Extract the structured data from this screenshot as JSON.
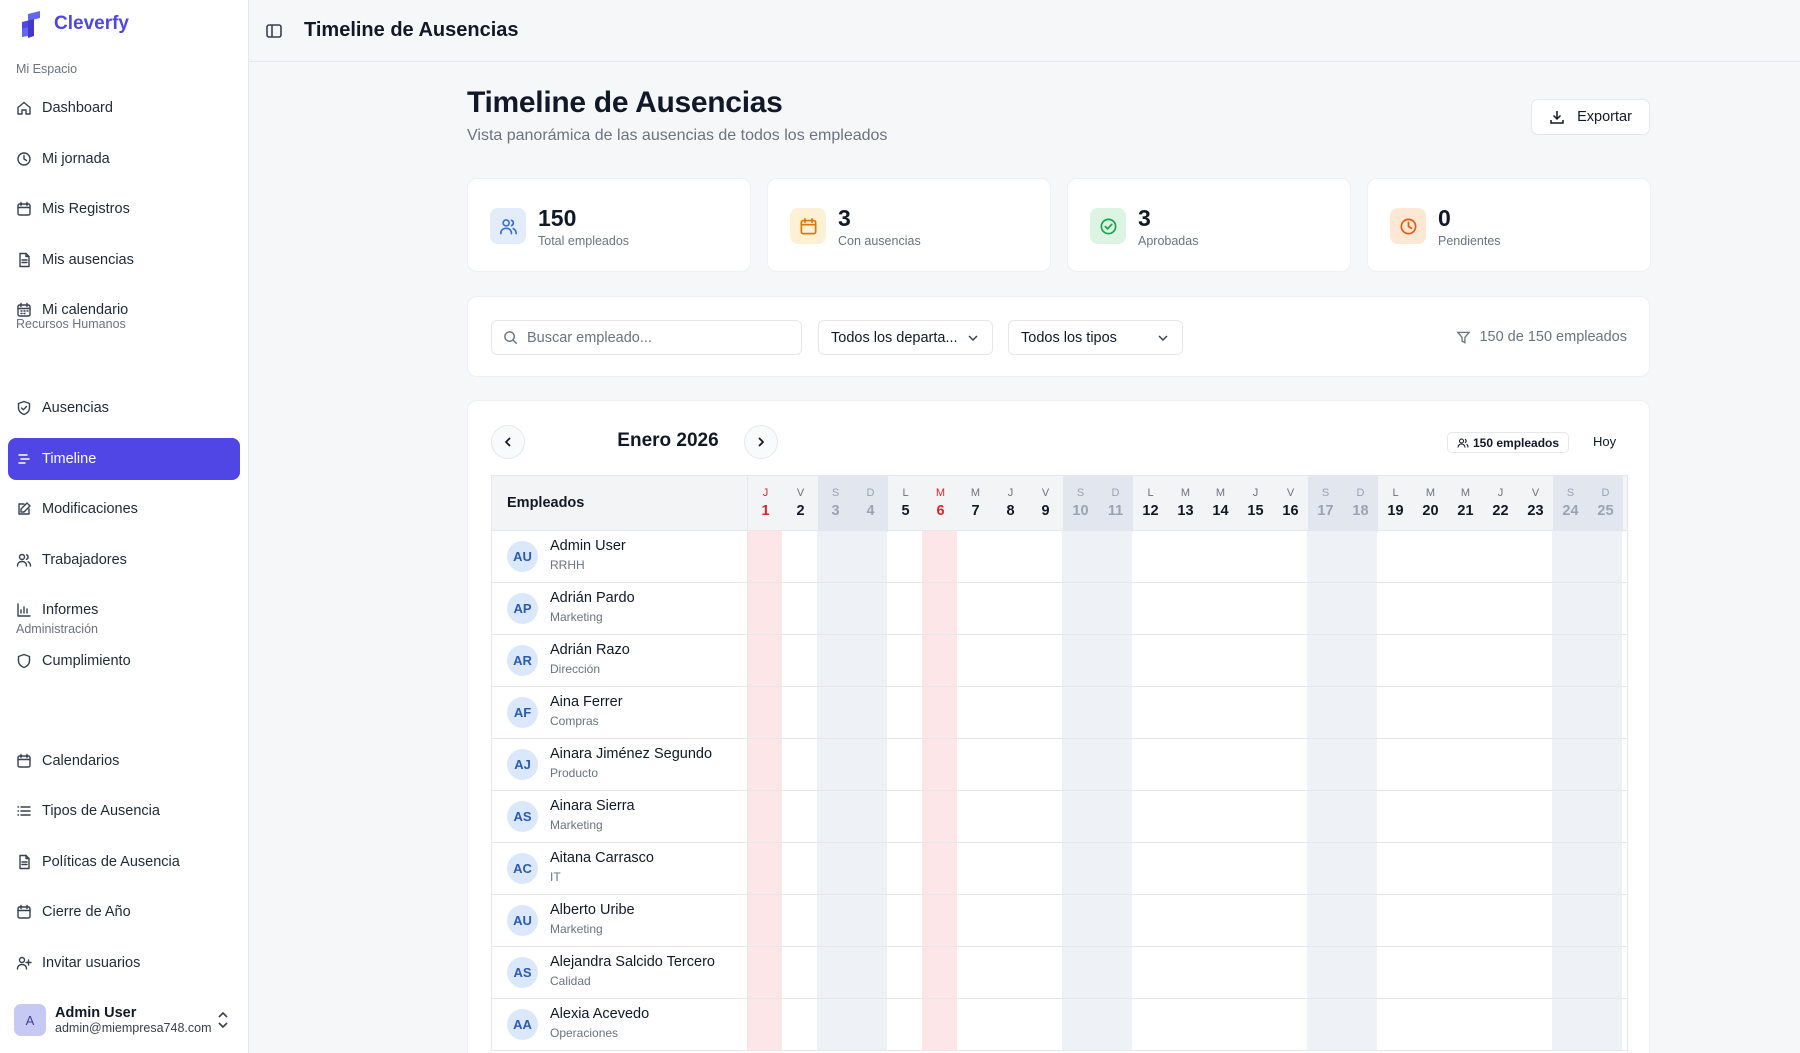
{
  "brand": {
    "name": "Cleverfy"
  },
  "sidebar": {
    "sections": [
      {
        "label": "Mi Espacio",
        "items": [
          {
            "label": "Dashboard",
            "icon": "home-icon"
          },
          {
            "label": "Mi jornada",
            "icon": "clock-icon"
          },
          {
            "label": "Mis Registros",
            "icon": "calendar-icon"
          },
          {
            "label": "Mis ausencias",
            "icon": "document-icon"
          },
          {
            "label": "Mi calendario",
            "icon": "calendar-grid-icon"
          }
        ]
      },
      {
        "label": "Recursos Humanos",
        "items": [
          {
            "label": "Ausencias",
            "icon": "shield-check-icon"
          },
          {
            "label": "Timeline",
            "icon": "timeline-icon",
            "active": true
          },
          {
            "label": "Modificaciones",
            "icon": "edit-icon"
          },
          {
            "label": "Trabajadores",
            "icon": "users-icon"
          },
          {
            "label": "Informes",
            "icon": "bar-chart-icon"
          },
          {
            "label": "Cumplimiento",
            "icon": "shield-icon"
          }
        ]
      },
      {
        "label": "Administración",
        "items": [
          {
            "label": "Calendarios",
            "icon": "calendar-icon"
          },
          {
            "label": "Tipos de Ausencia",
            "icon": "list-icon"
          },
          {
            "label": "Políticas de Ausencia",
            "icon": "document-icon"
          },
          {
            "label": "Cierre de Año",
            "icon": "calendar-icon"
          },
          {
            "label": "Invitar usuarios",
            "icon": "user-plus-icon"
          }
        ]
      }
    ],
    "user": {
      "initial": "A",
      "name": "Admin User",
      "email": "admin@miempresa748.com"
    }
  },
  "topbar": {
    "title": "Timeline de Ausencias"
  },
  "page": {
    "title": "Timeline de Ausencias",
    "subtitle": "Vista panorámica de las ausencias de todos los empleados",
    "export_label": "Exportar"
  },
  "stats": [
    {
      "value": "150",
      "label": "Total empleados",
      "icon": "users-icon",
      "color": "#3b6fd6",
      "bg": "#e3ecfb"
    },
    {
      "value": "3",
      "label": "Con ausencias",
      "icon": "calendar-icon",
      "color": "#d97706",
      "bg": "#fdf0d5"
    },
    {
      "value": "3",
      "label": "Aprobadas",
      "icon": "check-circle-icon",
      "color": "#16a34a",
      "bg": "#dcf5e3"
    },
    {
      "value": "0",
      "label": "Pendientes",
      "icon": "clock-icon",
      "color": "#ea580c",
      "bg": "#fde8d6"
    }
  ],
  "filters": {
    "search_placeholder": "Buscar empleado...",
    "department_value": "Todos los departa...",
    "type_value": "Todos los tipos",
    "count_text": "150 de 150 empleados"
  },
  "timeline": {
    "month": "Enero 2026",
    "employees_badge": "150 empleados",
    "today_label": "Hoy",
    "employees_header": "Empleados",
    "days": [
      {
        "dow": "J",
        "num": "1",
        "type": "holiday"
      },
      {
        "dow": "V",
        "num": "2",
        "type": "work"
      },
      {
        "dow": "S",
        "num": "3",
        "type": "weekend"
      },
      {
        "dow": "D",
        "num": "4",
        "type": "weekend"
      },
      {
        "dow": "L",
        "num": "5",
        "type": "work"
      },
      {
        "dow": "M",
        "num": "6",
        "type": "holiday"
      },
      {
        "dow": "M",
        "num": "7",
        "type": "work"
      },
      {
        "dow": "J",
        "num": "8",
        "type": "work"
      },
      {
        "dow": "V",
        "num": "9",
        "type": "work"
      },
      {
        "dow": "S",
        "num": "10",
        "type": "weekend"
      },
      {
        "dow": "D",
        "num": "11",
        "type": "weekend"
      },
      {
        "dow": "L",
        "num": "12",
        "type": "work"
      },
      {
        "dow": "M",
        "num": "13",
        "type": "work"
      },
      {
        "dow": "M",
        "num": "14",
        "type": "work"
      },
      {
        "dow": "J",
        "num": "15",
        "type": "work"
      },
      {
        "dow": "V",
        "num": "16",
        "type": "work"
      },
      {
        "dow": "S",
        "num": "17",
        "type": "weekend"
      },
      {
        "dow": "D",
        "num": "18",
        "type": "weekend"
      },
      {
        "dow": "L",
        "num": "19",
        "type": "work"
      },
      {
        "dow": "M",
        "num": "20",
        "type": "work"
      },
      {
        "dow": "M",
        "num": "21",
        "type": "work"
      },
      {
        "dow": "J",
        "num": "22",
        "type": "work"
      },
      {
        "dow": "V",
        "num": "23",
        "type": "work"
      },
      {
        "dow": "S",
        "num": "24",
        "type": "weekend"
      },
      {
        "dow": "D",
        "num": "25",
        "type": "weekend"
      }
    ],
    "employees": [
      {
        "initials": "AU",
        "name": "Admin User",
        "dept": "RRHH"
      },
      {
        "initials": "AP",
        "name": "Adrián Pardo",
        "dept": "Marketing"
      },
      {
        "initials": "AR",
        "name": "Adrián Razo",
        "dept": "Dirección"
      },
      {
        "initials": "AF",
        "name": "Aina Ferrer",
        "dept": "Compras"
      },
      {
        "initials": "AJ",
        "name": "Ainara Jiménez Segundo",
        "dept": "Producto"
      },
      {
        "initials": "AS",
        "name": "Ainara Sierra",
        "dept": "Marketing"
      },
      {
        "initials": "AC",
        "name": "Aitana Carrasco",
        "dept": "IT"
      },
      {
        "initials": "AU",
        "name": "Alberto Uribe",
        "dept": "Marketing"
      },
      {
        "initials": "AS",
        "name": "Alejandra Salcido Tercero",
        "dept": "Calidad"
      },
      {
        "initials": "AA",
        "name": "Alexia Acevedo",
        "dept": "Operaciones"
      }
    ]
  },
  "colors": {
    "accent": "#4f46e5",
    "holiday": "#dc2626",
    "weekend_bg": "#eef1f5",
    "holiday_bg": "#fde6e7"
  }
}
